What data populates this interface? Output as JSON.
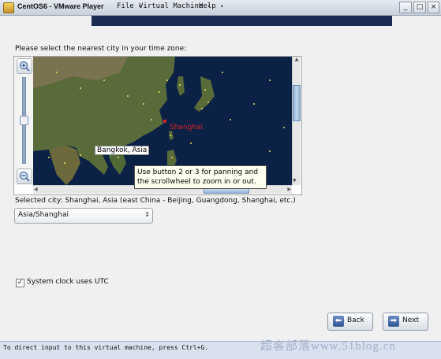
{
  "window": {
    "title": "CentOS6 - VMware Player",
    "menus": [
      "File",
      "Virtual Machine",
      "Help"
    ],
    "buttons": {
      "minimize": "_",
      "maximize": "□",
      "close": "×"
    }
  },
  "timezone": {
    "prompt": "Please select the nearest city in your time zone:",
    "map": {
      "label_shanghai": "Shanghai",
      "label_bangkok": "Bangkok, Asia",
      "tooltip_line1": "Use button 2 or 3 for panning and",
      "tooltip_line2": "the scrollwheel to zoom in or out."
    },
    "selected_city": "Selected city: Shanghai, Asia (east China - Beijing, Guangdong, Shanghai, etc.)",
    "selected_zone": "Asia/Shanghai",
    "utc_label": "System clock uses UTC",
    "utc_checked": true
  },
  "nav": {
    "back_label": "Back",
    "next_label": "Next"
  },
  "statusbar": {
    "message": "To direct input to this virtual machine, press Ctrl+G."
  },
  "watermark": "超客部落www.51blog.cn",
  "colors": {
    "map_ocean": "#0b2146",
    "map_land": "#5a6b3a",
    "accent": "#2f5597",
    "city_highlight": "#e02121"
  }
}
